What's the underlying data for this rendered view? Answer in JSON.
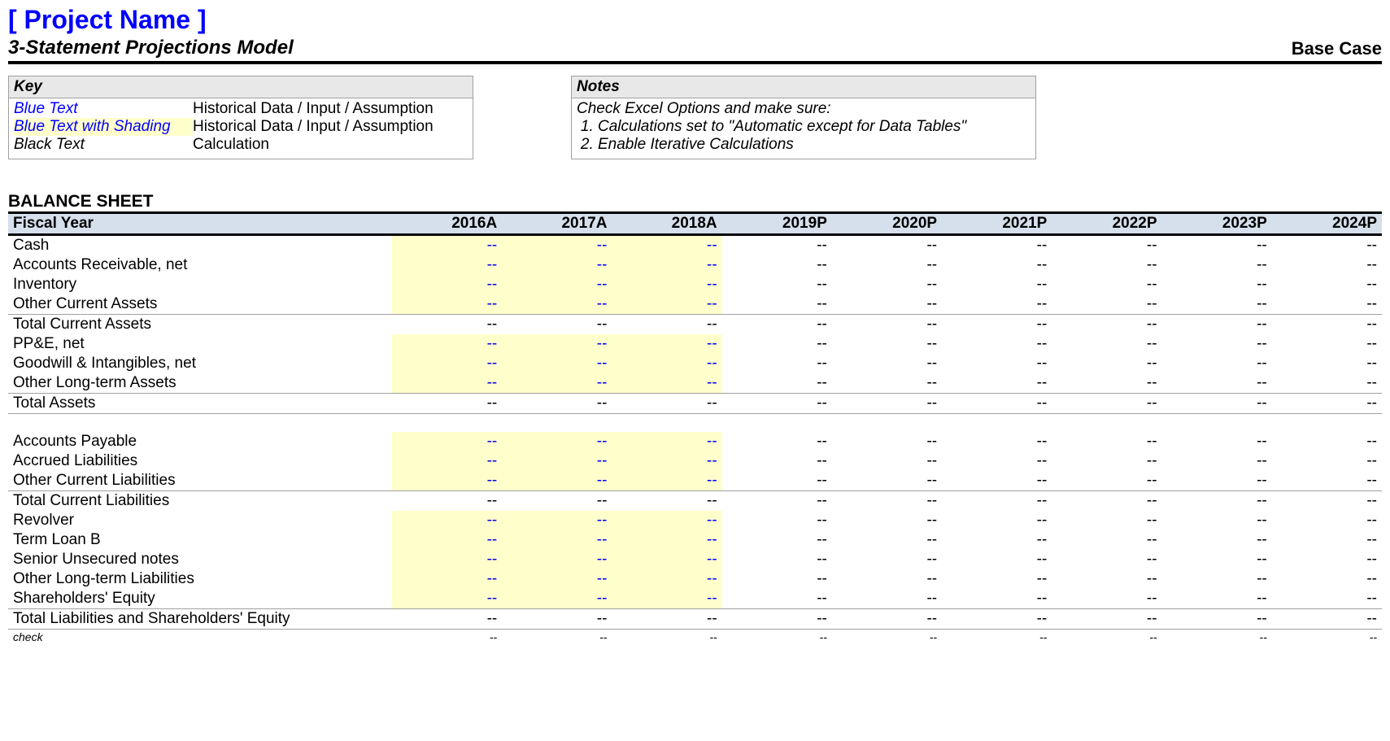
{
  "header": {
    "project": "[ Project Name ]",
    "subtitle": "3-Statement Projections Model",
    "case": "Base Case"
  },
  "key": {
    "title": "Key",
    "rows": [
      {
        "label": "Blue Text",
        "desc": "Historical Data / Input / Assumption",
        "cls": "blue-text"
      },
      {
        "label": "Blue Text with Shading",
        "desc": "Historical Data / Input / Assumption",
        "cls": "blue-text shaded"
      },
      {
        "label": "Black Text",
        "desc": "Calculation",
        "cls": ""
      }
    ]
  },
  "notes": {
    "title": "Notes",
    "intro": "Check Excel Options and make sure:",
    "items": [
      "Calculations set to \"Automatic except for Data Tables\"",
      "Enable Iterative Calculations"
    ]
  },
  "section_title": "BALANCE SHEET",
  "years_label": "Fiscal Year",
  "years": [
    "2016A",
    "2017A",
    "2018A",
    "2019P",
    "2020P",
    "2021P",
    "2022P",
    "2023P",
    "2024P"
  ],
  "historical_count": 3,
  "rows": [
    {
      "label": "Cash",
      "input": true
    },
    {
      "label": "Accounts Receivable, net",
      "input": true
    },
    {
      "label": "Inventory",
      "input": true
    },
    {
      "label": "Other Current Assets",
      "input": true,
      "divider_after": true
    },
    {
      "label": "Total Current Assets",
      "input": false
    },
    {
      "label": "PP&E, net",
      "input": true
    },
    {
      "label": "Goodwill & Intangibles, net",
      "input": true
    },
    {
      "label": "Other Long-term Assets",
      "input": true,
      "divider_after": true
    },
    {
      "label": "Total Assets",
      "input": false,
      "divider_after": true
    },
    {
      "spacer": true
    },
    {
      "label": "Accounts Payable",
      "input": true
    },
    {
      "label": "Accrued Liabilities",
      "input": true
    },
    {
      "label": "Other Current Liabilities",
      "input": true,
      "divider_after": true
    },
    {
      "label": "Total Current Liabilities",
      "input": false
    },
    {
      "label": "Revolver",
      "input": true
    },
    {
      "label": "Term Loan B",
      "input": true
    },
    {
      "label": "Senior Unsecured notes",
      "input": true
    },
    {
      "label": "Other Long-term Liabilities",
      "input": true
    },
    {
      "label": "Shareholders' Equity",
      "input": true,
      "divider_after": true
    },
    {
      "label": "Total Liabilities and Shareholders' Equity",
      "input": false,
      "divider_after": true
    },
    {
      "label": "check",
      "input": false,
      "check": true
    }
  ],
  "placeholder": "--"
}
